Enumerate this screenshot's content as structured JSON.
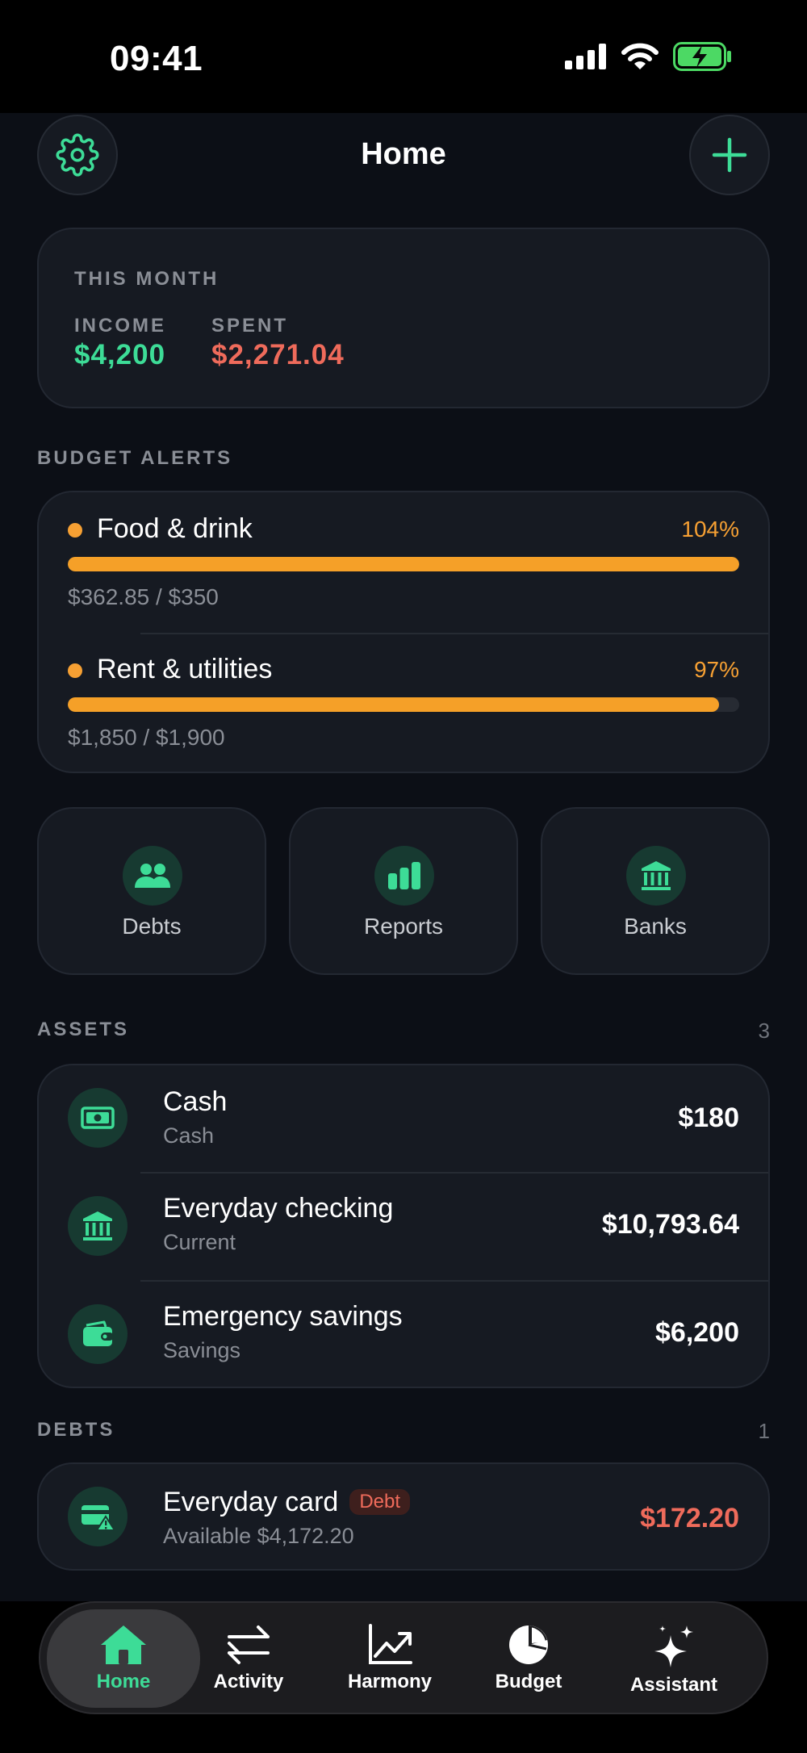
{
  "status_bar": {
    "time": "09:41"
  },
  "header": {
    "title": "Home"
  },
  "summary": {
    "period_label": "THIS MONTH",
    "income_label": "INCOME",
    "income_value": "$4,200",
    "spent_label": "SPENT",
    "spent_value": "$2,271.04"
  },
  "budget_alerts": {
    "label": "BUDGET ALERTS",
    "items": [
      {
        "name": "Food & drink",
        "percent_label": "104%",
        "fill": 1.0,
        "amounts": "$362.85 / $350"
      },
      {
        "name": "Rent & utilities",
        "percent_label": "97%",
        "fill": 0.97,
        "amounts": "$1,850 / $1,900"
      }
    ]
  },
  "quick_actions": [
    {
      "label": "Debts",
      "icon": "people-icon"
    },
    {
      "label": "Reports",
      "icon": "bar-chart-icon"
    },
    {
      "label": "Banks",
      "icon": "bank-icon"
    }
  ],
  "assets": {
    "label": "ASSETS",
    "count": "3",
    "items": [
      {
        "name": "Cash",
        "sub": "Cash",
        "value": "$180",
        "icon": "banknote-icon"
      },
      {
        "name": "Everyday checking",
        "sub": "Current",
        "value": "$10,793.64",
        "icon": "bank-icon"
      },
      {
        "name": "Emergency savings",
        "sub": "Savings",
        "value": "$6,200",
        "icon": "wallet-icon"
      }
    ]
  },
  "debts": {
    "label": "DEBTS",
    "count": "1",
    "items": [
      {
        "name": "Everyday card",
        "badge": "Debt",
        "sub": "Available $4,172.20",
        "value": "$172.20",
        "icon": "credit-card-alert-icon"
      }
    ]
  },
  "tabs": [
    {
      "label": "Home",
      "icon": "house-icon",
      "active": true
    },
    {
      "label": "Activity",
      "icon": "arrows-swap-icon",
      "active": false
    },
    {
      "label": "Harmony",
      "icon": "trend-chart-icon",
      "active": false
    },
    {
      "label": "Budget",
      "icon": "pie-chart-icon",
      "active": false
    },
    {
      "label": "Assistant",
      "icon": "sparkles-icon",
      "active": false
    }
  ],
  "colors": {
    "accent": "#3ddc97",
    "expense": "#ef6b5b",
    "warning": "#f6a033",
    "background": "#0c0f16",
    "card": "#161a22"
  }
}
